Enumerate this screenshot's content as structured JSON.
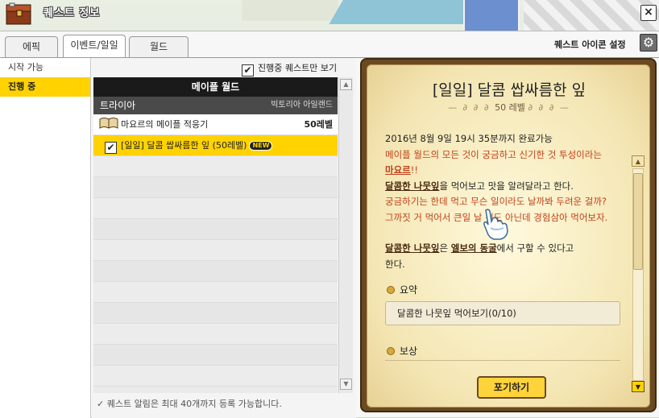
{
  "window": {
    "title": "퀘스트 정보",
    "close_label": "×"
  },
  "tabs": [
    {
      "label": "에픽",
      "active": false
    },
    {
      "label": "이벤트/일일",
      "active": true
    },
    {
      "label": "월드",
      "active": false
    }
  ],
  "header": {
    "icon_setting_label": "퀘스트 아이콘 설정",
    "icon_setting_icon": "gear-icon"
  },
  "sidebar": {
    "items": [
      {
        "label": "시작 가능",
        "active": false
      },
      {
        "label": "진행 중",
        "active": true
      }
    ]
  },
  "list": {
    "filter_label": "진행중 퀘스트만 보기",
    "filter_checked": true,
    "region": "메이플 월드",
    "subregion": {
      "name": "트라이아",
      "area": "빅토리아 아일랜드"
    },
    "quests": [
      {
        "title": "마요르의 메이플 적응기",
        "level": "50레벨",
        "icon": "book-icon",
        "selected": false
      },
      {
        "title": "[일일] 달콤 쌉싸름한 잎 (50레벨)",
        "badge": "NEW",
        "icon": "checkbox-icon",
        "selected": true
      }
    ],
    "footer_note": "퀘스트 알림은 최대 40개까지 등록 가능합니다."
  },
  "detail": {
    "title": "[일일] 달콤 쌉싸름한 잎",
    "level": "50 레벨",
    "deadline": "2016년 8월 9일 19시 35분까지 완료가능",
    "line1": "메이플 월드의 모든 것이 궁금하고 신기한 것 투성이라는",
    "npc": "마요르",
    "npc_suffix": "!!",
    "item_name": "달콤한 나뭇잎",
    "line3_suffix": "을 먹어보고 맛을 알려달라고 한다.",
    "line4": "궁금하기는 한데 먹고 무슨 일이라도 날까봐 두려운 걸까?",
    "line5": "그까짓 거 먹어서 큰일 날 것도 아닌데 경험삼아 먹어보자.",
    "item_name_2": "달콤한 나뭇잎",
    "line6_mid": "은 ",
    "place": "엘보의 동",
    "place_hidden": "굴",
    "line6_end": "에서 구할 수 있다고",
    "line7": "한다.",
    "summary_label": "요약",
    "summary_text": "달콤한 나뭇잎 먹어보기(0/10)",
    "reward_label": "보상",
    "giveup_label": "포기하기"
  },
  "colors": {
    "accent_yellow": "#ffd200",
    "parchment": "#f4e6b4",
    "frame_brown": "#6b4a22",
    "highlight_red": "#c0401a"
  }
}
